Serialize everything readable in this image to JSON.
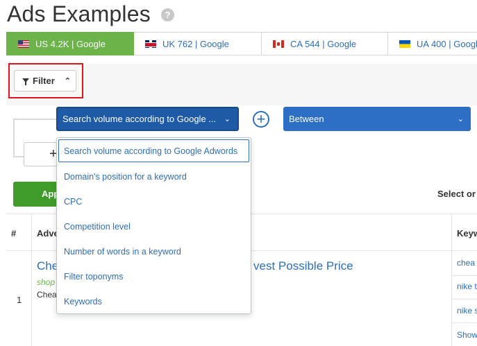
{
  "header": {
    "title": "Ads Examples",
    "help": "?"
  },
  "tabs": [
    {
      "label": "US 4.2K | Google",
      "flag": "us",
      "active": true
    },
    {
      "label": "UK 762 | Google",
      "flag": "uk",
      "active": false
    },
    {
      "label": "CA 544 | Google",
      "flag": "ca",
      "active": false
    },
    {
      "label": "UA 400 | Google",
      "flag": "ua",
      "active": false
    }
  ],
  "filter": {
    "label": "Filter",
    "chevron": "^",
    "field_value": "Search volume according to Google ...",
    "operator_value": "Between",
    "add_label": "+",
    "plus": "+"
  },
  "dropdown": {
    "options": [
      "Search volume according to Google Adwords",
      "Domain's position for a keyword",
      "CPC",
      "Competition level",
      "Number of words in a keyword",
      "Filter toponyms",
      "Keywords"
    ]
  },
  "actions": {
    "apply_label": "Apply",
    "select_text": "Select or S"
  },
  "table": {
    "headers": {
      "num": "#",
      "ad": "Adve",
      "keywords": "Keyw"
    },
    "rows": [
      {
        "num": "1",
        "title_start": "Che",
        "title_end": "vest Possible Price",
        "url": "shop",
        "desc": "Chea",
        "keywords": [
          "chea",
          "nike t",
          "nike s",
          "Show"
        ]
      }
    ]
  },
  "colors": {
    "accent": "#2d6fb8",
    "active_tab": "#6cb34a",
    "apply": "#3f9c2a",
    "highlight": "#e0141d"
  }
}
